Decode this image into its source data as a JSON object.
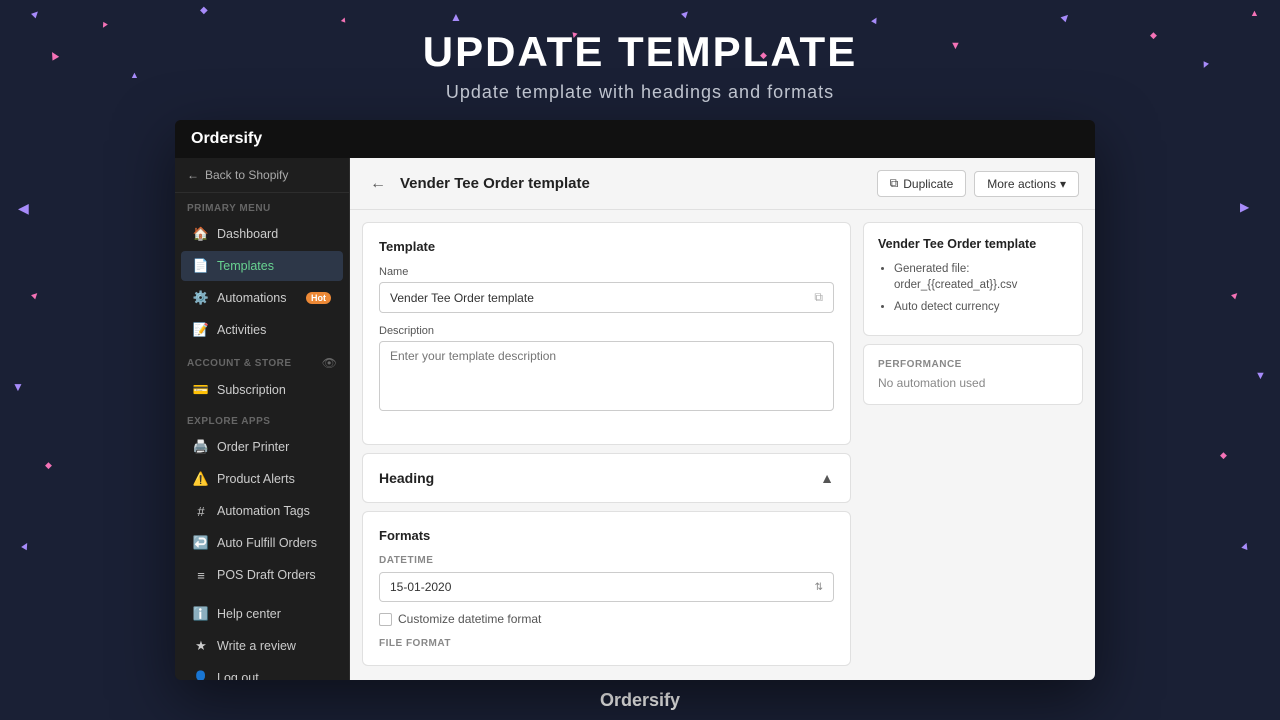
{
  "hero": {
    "title": "UPDATE TEMPLATE",
    "subtitle": "Update template with headings and formats"
  },
  "app": {
    "logo": "Ordersify"
  },
  "sidebar": {
    "back_label": "Back to Shopify",
    "primary_menu_label": "PRIMARY MENU",
    "items_primary": [
      {
        "id": "dashboard",
        "label": "Dashboard",
        "icon": "🏠",
        "active": false
      },
      {
        "id": "templates",
        "label": "Templates",
        "icon": "📄",
        "active": true
      },
      {
        "id": "automations",
        "label": "Automations",
        "icon": "⚙️",
        "active": false,
        "badge": "Hot"
      },
      {
        "id": "activities",
        "label": "Activities",
        "icon": "📝",
        "active": false
      }
    ],
    "account_section_label": "ACCOUNT & STORE",
    "items_account": [
      {
        "id": "subscription",
        "label": "Subscription",
        "icon": "💳"
      }
    ],
    "explore_section_label": "EXPLORE APPS",
    "items_explore": [
      {
        "id": "order-printer",
        "label": "Order Printer",
        "icon": "🖨️"
      },
      {
        "id": "product-alerts",
        "label": "Product Alerts",
        "icon": "⚠️"
      },
      {
        "id": "automation-tags",
        "label": "Automation Tags",
        "icon": "#"
      },
      {
        "id": "auto-fulfill",
        "label": "Auto Fulfill Orders",
        "icon": "↩️"
      },
      {
        "id": "pos-draft",
        "label": "POS Draft Orders",
        "icon": "≡"
      }
    ],
    "items_bottom": [
      {
        "id": "help-center",
        "label": "Help center",
        "icon": "ℹ️"
      },
      {
        "id": "write-review",
        "label": "Write a review",
        "icon": "★"
      },
      {
        "id": "log-out",
        "label": "Log out",
        "icon": "👤"
      }
    ]
  },
  "content_header": {
    "title": "Vender Tee Order template",
    "duplicate_label": "Duplicate",
    "more_actions_label": "More actions"
  },
  "template_card": {
    "section_title": "Template",
    "name_label": "Name",
    "name_value": "Vender Tee Order template",
    "description_label": "Description",
    "description_placeholder": "Enter your template description"
  },
  "heading_section": {
    "label": "Heading"
  },
  "formats_card": {
    "title": "Formats",
    "datetime_label": "DATETIME",
    "datetime_value": "15-01-2020",
    "customize_label": "Customize datetime format",
    "file_format_label": "FILE FORMAT"
  },
  "info_card": {
    "title": "Vender Tee Order template",
    "items": [
      "Generated file: order_{{created_at}}.csv",
      "Auto detect currency"
    ]
  },
  "performance_card": {
    "label": "PERFORMANCE",
    "value": "No automation used"
  },
  "footer": {
    "brand": "Ordersify"
  }
}
